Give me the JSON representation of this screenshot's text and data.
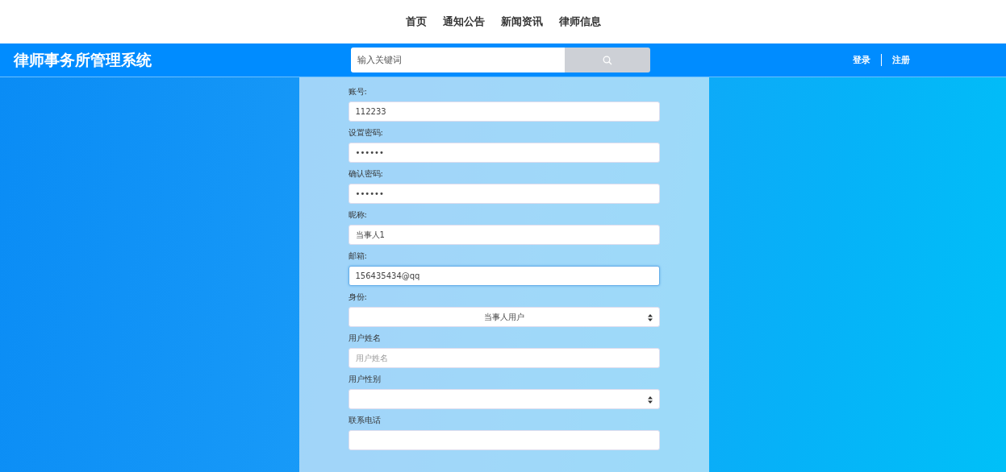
{
  "top_nav": [
    {
      "label": "首页"
    },
    {
      "label": "通知公告"
    },
    {
      "label": "新闻资讯"
    },
    {
      "label": "律师信息"
    }
  ],
  "header": {
    "title": "律师事务所管理系统",
    "search": {
      "placeholder": "输入关键词"
    },
    "links": [
      {
        "label": "登录"
      },
      {
        "label": "注册"
      }
    ]
  },
  "form": {
    "fields": [
      {
        "label": "账号:",
        "kind": "text",
        "value": "112233",
        "focused": false
      },
      {
        "label": "设置密码:",
        "kind": "text",
        "value": "••••••",
        "focused": false
      },
      {
        "label": "确认密码:",
        "kind": "text",
        "value": "••••••",
        "focused": false
      },
      {
        "label": "昵称:",
        "kind": "text",
        "value": "当事人1",
        "focused": false
      },
      {
        "label": "邮箱:",
        "kind": "text",
        "value": "156435434@qq",
        "focused": true
      },
      {
        "label": "身份:",
        "kind": "select",
        "value": "当事人用户",
        "focused": false
      },
      {
        "label": "用户姓名",
        "kind": "text",
        "placeholder": "用户姓名",
        "focused": false
      },
      {
        "label": "用户性别",
        "kind": "select",
        "focused": false
      },
      {
        "label": "联系电话",
        "kind": "text",
        "focused": false
      }
    ]
  }
}
